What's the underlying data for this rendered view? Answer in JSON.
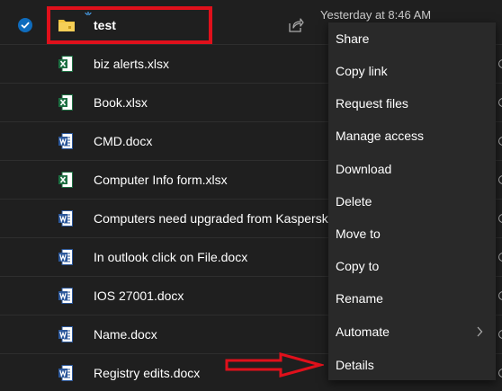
{
  "files": {
    "selected_row": {
      "name": "test",
      "type": "folder",
      "modified": "Yesterday at 8:46 AM"
    },
    "rows": [
      {
        "name": "biz alerts.xlsx",
        "type": "excel"
      },
      {
        "name": "Book.xlsx",
        "type": "excel"
      },
      {
        "name": "CMD.docx",
        "type": "word"
      },
      {
        "name": "Computer Info form.xlsx",
        "type": "excel"
      },
      {
        "name": "Computers need upgraded from Kaspersky",
        "type": "word"
      },
      {
        "name": "In outlook click on File.docx",
        "type": "word"
      },
      {
        "name": "IOS 27001.docx",
        "type": "word"
      },
      {
        "name": "Name.docx",
        "type": "word"
      },
      {
        "name": "Registry edits.docx",
        "type": "word"
      }
    ]
  },
  "context_menu": {
    "items": [
      {
        "label": "Share"
      },
      {
        "label": "Copy link"
      },
      {
        "label": "Request files"
      },
      {
        "label": "Manage access"
      },
      {
        "label": "Download"
      },
      {
        "label": "Delete"
      },
      {
        "label": "Move to"
      },
      {
        "label": "Copy to"
      },
      {
        "label": "Rename"
      },
      {
        "label": "Automate",
        "has_submenu": true
      },
      {
        "label": "Details"
      }
    ]
  },
  "icons": {
    "check": "check-circle-icon",
    "folder": "folder-icon",
    "excel": "excel-file-icon",
    "word": "word-file-icon",
    "share": "share-icon",
    "chevron": "chevron-right-icon"
  },
  "colors": {
    "background": "#1f1f1f",
    "menu_background": "#292929",
    "check_blue": "#0f6cbd",
    "folder_yellow": "#f0c43c",
    "excel_green": "#1d6f42",
    "word_blue": "#2b579a",
    "annotation_red": "#e0101b"
  }
}
